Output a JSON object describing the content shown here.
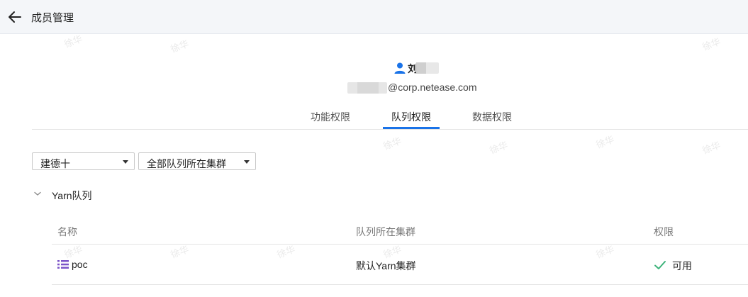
{
  "header": {
    "title": "成员管理",
    "back_icon": "arrow-left-icon"
  },
  "user": {
    "icon": "user-icon",
    "name_visible_char": "刘",
    "email_domain": "@corp.netease.com",
    "accent_color": "#1a73e8"
  },
  "tabs": [
    {
      "label": "功能权限",
      "active": false
    },
    {
      "label": "队列权限",
      "active": true
    },
    {
      "label": "数据权限",
      "active": false
    }
  ],
  "filters": {
    "project_select": "建德十",
    "cluster_select": "全部队列所在集群"
  },
  "section": {
    "title": "Yarn队列",
    "expanded": true
  },
  "table": {
    "columns": [
      "名称",
      "队列所在集群",
      "权限"
    ],
    "rows": [
      {
        "name": "poc",
        "cluster": "默认Yarn集群",
        "permission": "可用",
        "permission_color": "#3db37a"
      }
    ]
  },
  "watermark": "徐华"
}
